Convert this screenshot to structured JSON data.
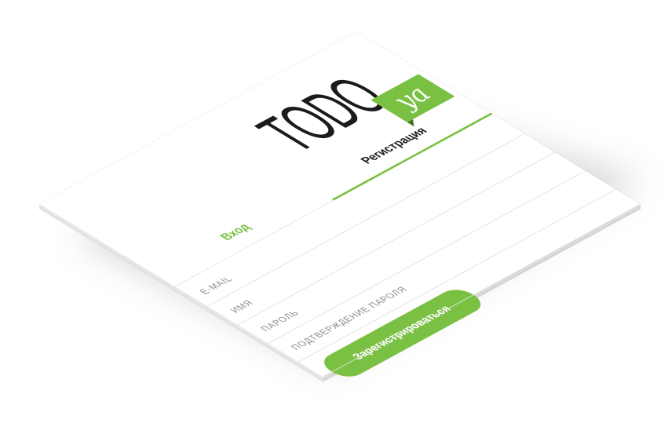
{
  "logo": {
    "word": "TODO",
    "badge": "ya"
  },
  "tabs": [
    {
      "label": "Вход",
      "active": false
    },
    {
      "label": "Регистрация",
      "active": true
    }
  ],
  "form": {
    "fields": [
      {
        "placeholder": "E-MAIL",
        "value": ""
      },
      {
        "placeholder": "ИМЯ",
        "value": ""
      },
      {
        "placeholder": "ПАРОЛЬ",
        "value": ""
      },
      {
        "placeholder": "ПОДТВЕРЖДЕНИЕ ПАРОЛЯ",
        "value": ""
      }
    ],
    "submit_label": "Зарегистрироваться"
  },
  "colors": {
    "accent": "#7ac143",
    "text_dark": "#1b1b1b",
    "placeholder": "#8a8a8a"
  }
}
